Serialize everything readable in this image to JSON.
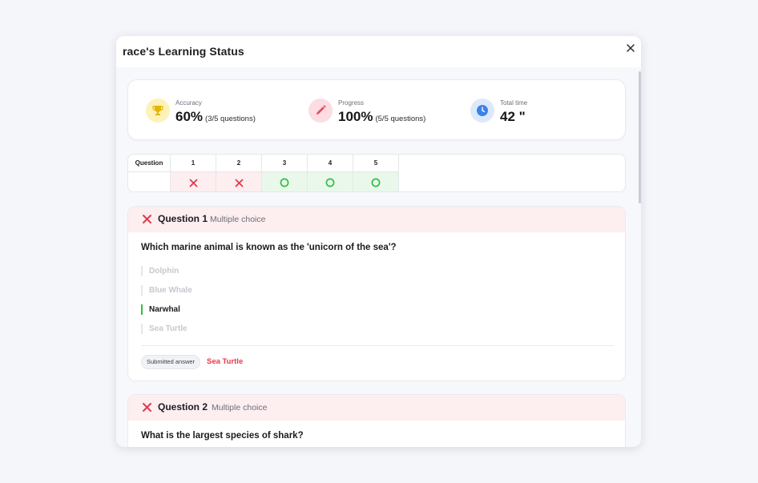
{
  "modal": {
    "title": "race's Learning Status",
    "close_icon": "close-icon"
  },
  "stats": {
    "accuracy": {
      "label": "Accuracy",
      "value": "60%",
      "sub": "(3/5 questions)",
      "icon": "trophy-icon",
      "icon_bg": "#fdf2b8",
      "icon_color": "#e7b400"
    },
    "progress": {
      "label": "Progress",
      "value": "100%",
      "sub": "(5/5 questions)",
      "icon": "pencil-icon",
      "icon_bg": "#fbdde2",
      "icon_color": "#e55068"
    },
    "total_time": {
      "label": "Total time",
      "value": "42 \"",
      "icon": "clock-icon",
      "icon_bg": "#dde9fb",
      "icon_color": "#3a83ea"
    }
  },
  "grid": {
    "header_label": "Question",
    "questions": [
      {
        "number": "1",
        "result": "wrong",
        "icon": "x-mark-icon"
      },
      {
        "number": "2",
        "result": "wrong",
        "icon": "x-mark-icon"
      },
      {
        "number": "3",
        "result": "correct",
        "icon": "circle-icon"
      },
      {
        "number": "4",
        "result": "correct",
        "icon": "circle-icon"
      },
      {
        "number": "5",
        "result": "correct",
        "icon": "circle-icon"
      }
    ]
  },
  "question_cards": [
    {
      "number_label": "Question 1",
      "type_label": "Multiple choice",
      "text": "Which marine animal is known as the 'unicorn of the sea'?",
      "options": [
        "Dolphin",
        "Blue Whale",
        "Narwhal",
        "Sea Turtle"
      ],
      "correct_option": "Narwhal",
      "submitted_label": "Submitted answer",
      "submitted_value": "Sea Turtle"
    },
    {
      "number_label": "Question 2",
      "type_label": "Multiple choice",
      "text": "What is the largest species of shark?"
    }
  ],
  "colors": {
    "wrong": "#e2394b",
    "correct": "#2fbf44",
    "wrong_bg": "#fdeef0",
    "correct_bg": "#e9f8ea"
  }
}
